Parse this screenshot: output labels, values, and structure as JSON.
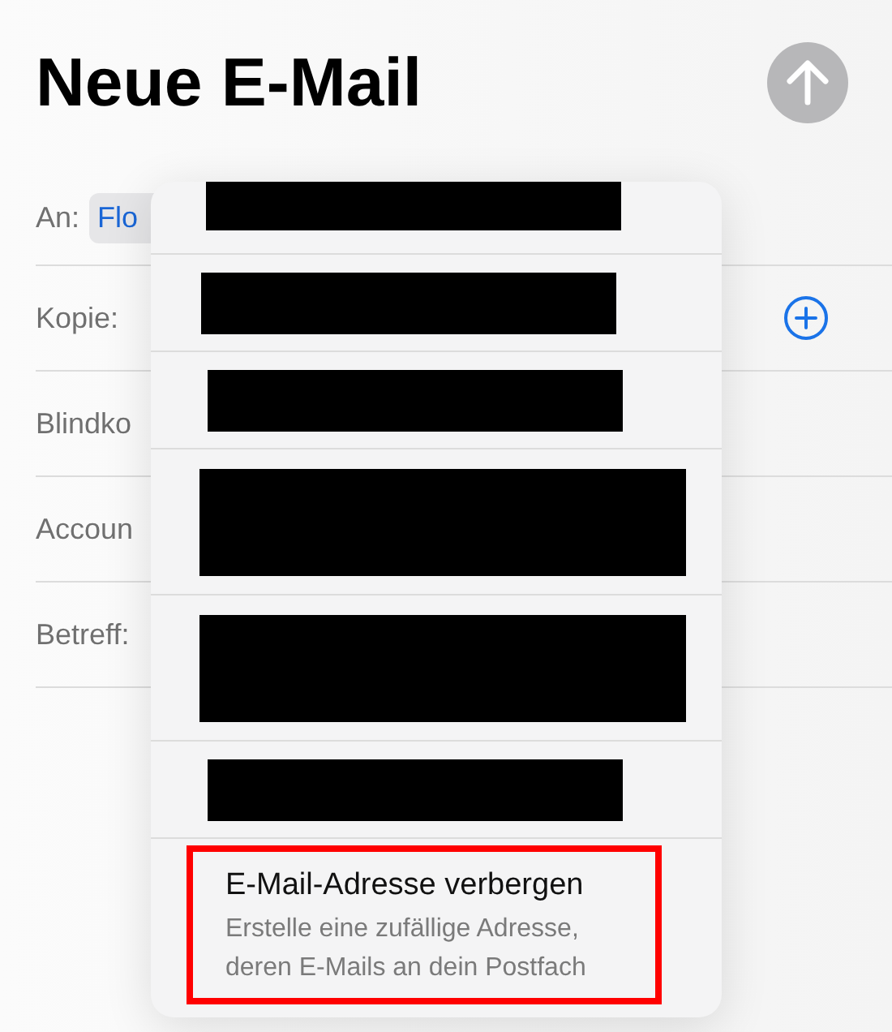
{
  "title": "Neue E-Mail",
  "fields": [
    {
      "label": "An:",
      "chip": "Flo"
    },
    {
      "label": "Kopie:",
      "add_button": true
    },
    {
      "label": "Blindko"
    },
    {
      "label": "Accoun"
    },
    {
      "label": "Betreff:"
    }
  ],
  "menu": [
    {
      "kind": "redacted",
      "tall": false
    },
    {
      "kind": "redacted",
      "tall": false
    },
    {
      "kind": "redacted",
      "tall": false
    },
    {
      "kind": "redacted",
      "tall": true
    },
    {
      "kind": "redacted",
      "tall": true
    },
    {
      "kind": "redacted",
      "tall": false
    },
    {
      "kind": "option",
      "title": "E-Mail-Adresse verbergen",
      "subtitle": "Erstelle eine zufällige Adresse, deren E-Mails an dein Postfach",
      "highlighted": true
    }
  ]
}
